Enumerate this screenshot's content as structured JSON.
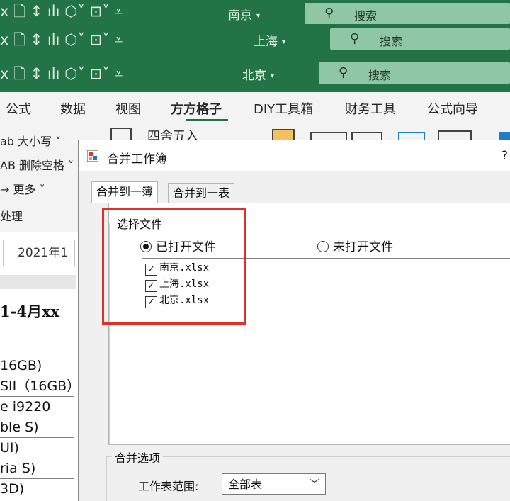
{
  "windows": [
    {
      "city": "南京",
      "search": "搜索"
    },
    {
      "city": "上海",
      "search": "搜索"
    },
    {
      "city": "北京",
      "search": "搜索"
    }
  ],
  "ribbon": {
    "tabs": [
      "公式",
      "数据",
      "视图",
      "方方格子",
      "DIY工具箱",
      "财务工具",
      "公式向导"
    ],
    "active_tab": "方方格子",
    "items": {
      "case": "ab 大小写 ˅",
      "delete_space": "AB 删除空格 ˅",
      "more": "→ 更多 ˅",
      "process": "处理",
      "round": "四舍五入"
    }
  },
  "sheet": {
    "namebox": "2021年1",
    "title_cell": "1-4月xx",
    "rows": [
      "16GB)",
      "SII（16GB）",
      "e i9220",
      "ble S)",
      "UI)",
      "ria S)",
      "3D)"
    ]
  },
  "dialog": {
    "title": "合并工作簿",
    "help": "?",
    "tabs": [
      "合并到一簿",
      "合并到一表"
    ],
    "group_title": "选择文件",
    "radio_open": "已打开文件",
    "radio_closed": "未打开文件",
    "files": [
      "南京.xlsx",
      "上海.xlsx",
      "北京.xlsx"
    ],
    "merge_options": "合并选项",
    "range_label": "工作表范围:",
    "range_value": "全部表"
  },
  "colors": {
    "title_bar": "#227447",
    "search_box": "#8fc6a4",
    "highlight": "#e0302c"
  }
}
